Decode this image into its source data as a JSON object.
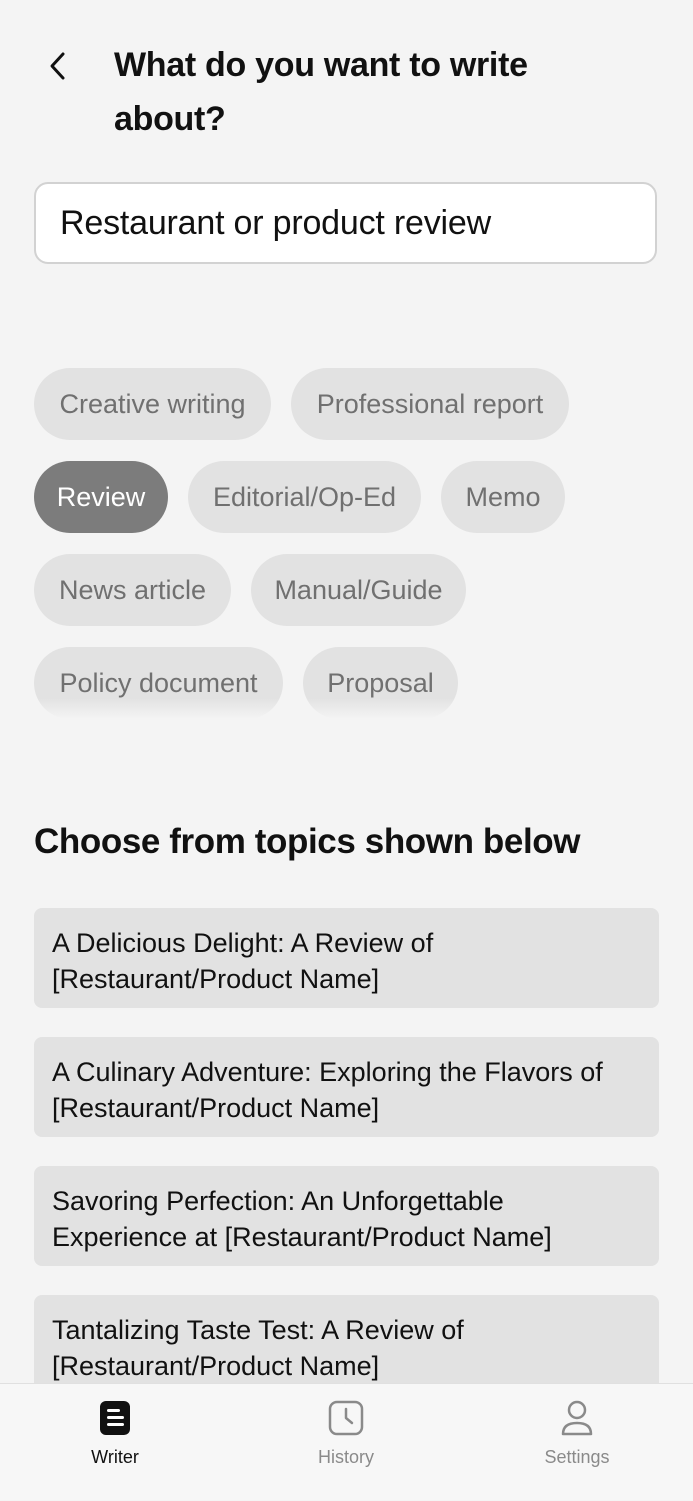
{
  "header": {
    "title": "What do you want to write about?",
    "back_icon": "chevron-left-icon"
  },
  "input": {
    "value": "Restaurant or product review"
  },
  "chips": {
    "selected": "Review",
    "items": [
      {
        "label": "Creative writing",
        "selected": false
      },
      {
        "label": "Professional report",
        "selected": false
      },
      {
        "label": "Review",
        "selected": true
      },
      {
        "label": "Editorial/Op-Ed",
        "selected": false
      },
      {
        "label": "Memo",
        "selected": false
      },
      {
        "label": "News article",
        "selected": false
      },
      {
        "label": "Manual/Guide",
        "selected": false
      },
      {
        "label": "Policy document",
        "selected": false
      },
      {
        "label": "Proposal",
        "selected": false
      }
    ]
  },
  "topics": {
    "heading": "Choose from topics shown below",
    "items": [
      "A Delicious Delight: A Review of [Restaurant/Product Name]",
      "A Culinary Adventure: Exploring the Flavors of [Restaurant/Product Name]",
      "Savoring Perfection: An Unforgettable Experience at [Restaurant/Product Name]",
      "Tantalizing Taste Test: A Review of [Restaurant/Product Name]"
    ]
  },
  "tabbar": {
    "tabs": [
      {
        "label": "Writer",
        "icon": "writer-icon",
        "active": true
      },
      {
        "label": "History",
        "icon": "clock-icon",
        "active": false
      },
      {
        "label": "Settings",
        "icon": "person-icon",
        "active": false
      }
    ]
  },
  "colors": {
    "background": "#f4f4f4",
    "chip": "#e2e2e2",
    "chip_selected": "#7c7c7c",
    "card": "#e2e2e2",
    "text": "#111111",
    "muted": "#8a8a8a"
  }
}
